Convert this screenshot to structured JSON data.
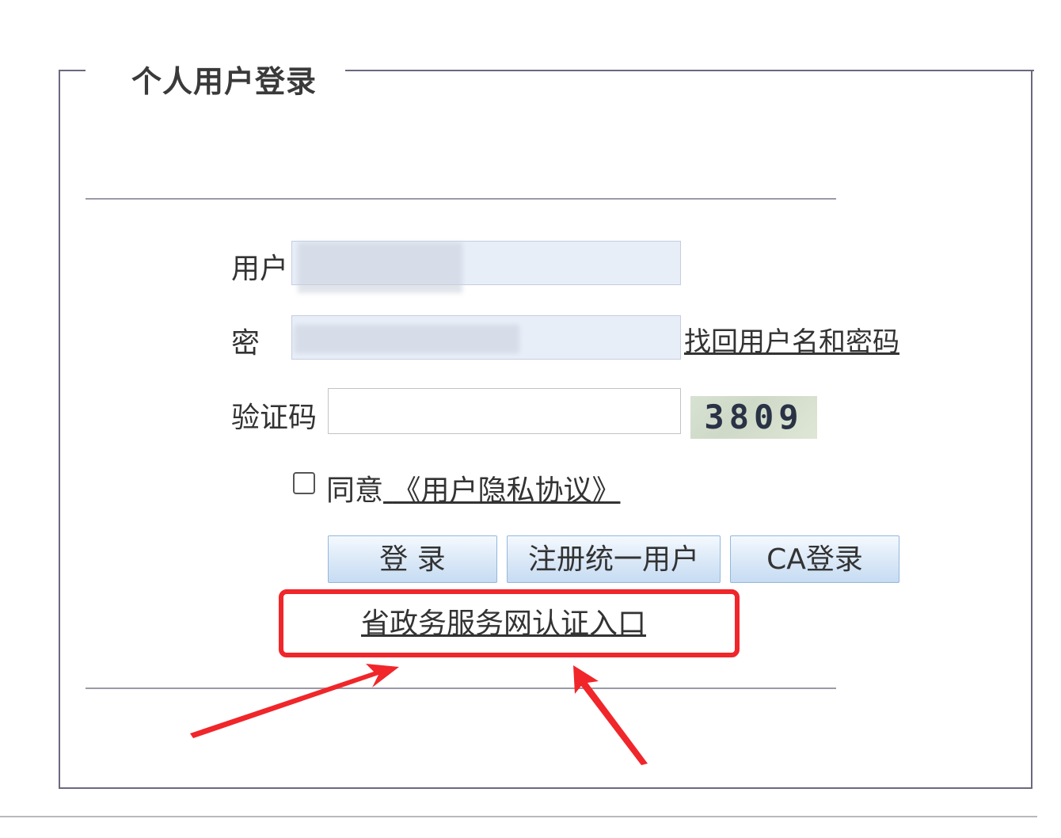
{
  "panel": {
    "title": "个人用户登录"
  },
  "form": {
    "username_label": "用户",
    "password_label": "密",
    "captcha_label": "验证码",
    "captcha_code": "3809",
    "recover_link": "找回用户名和密码",
    "agree_prefix": "同意",
    "agree_policy": "《用户隐私协议》"
  },
  "buttons": {
    "login": "登 录",
    "register": "注册统一用户",
    "ca_login": "CA登录"
  },
  "gov_link": "省政务服务网认证入口",
  "colors": {
    "annotation_red": "#f0262a",
    "button_gradient_start": "#f4f9ff",
    "button_gradient_end": "#c6dcf3"
  }
}
